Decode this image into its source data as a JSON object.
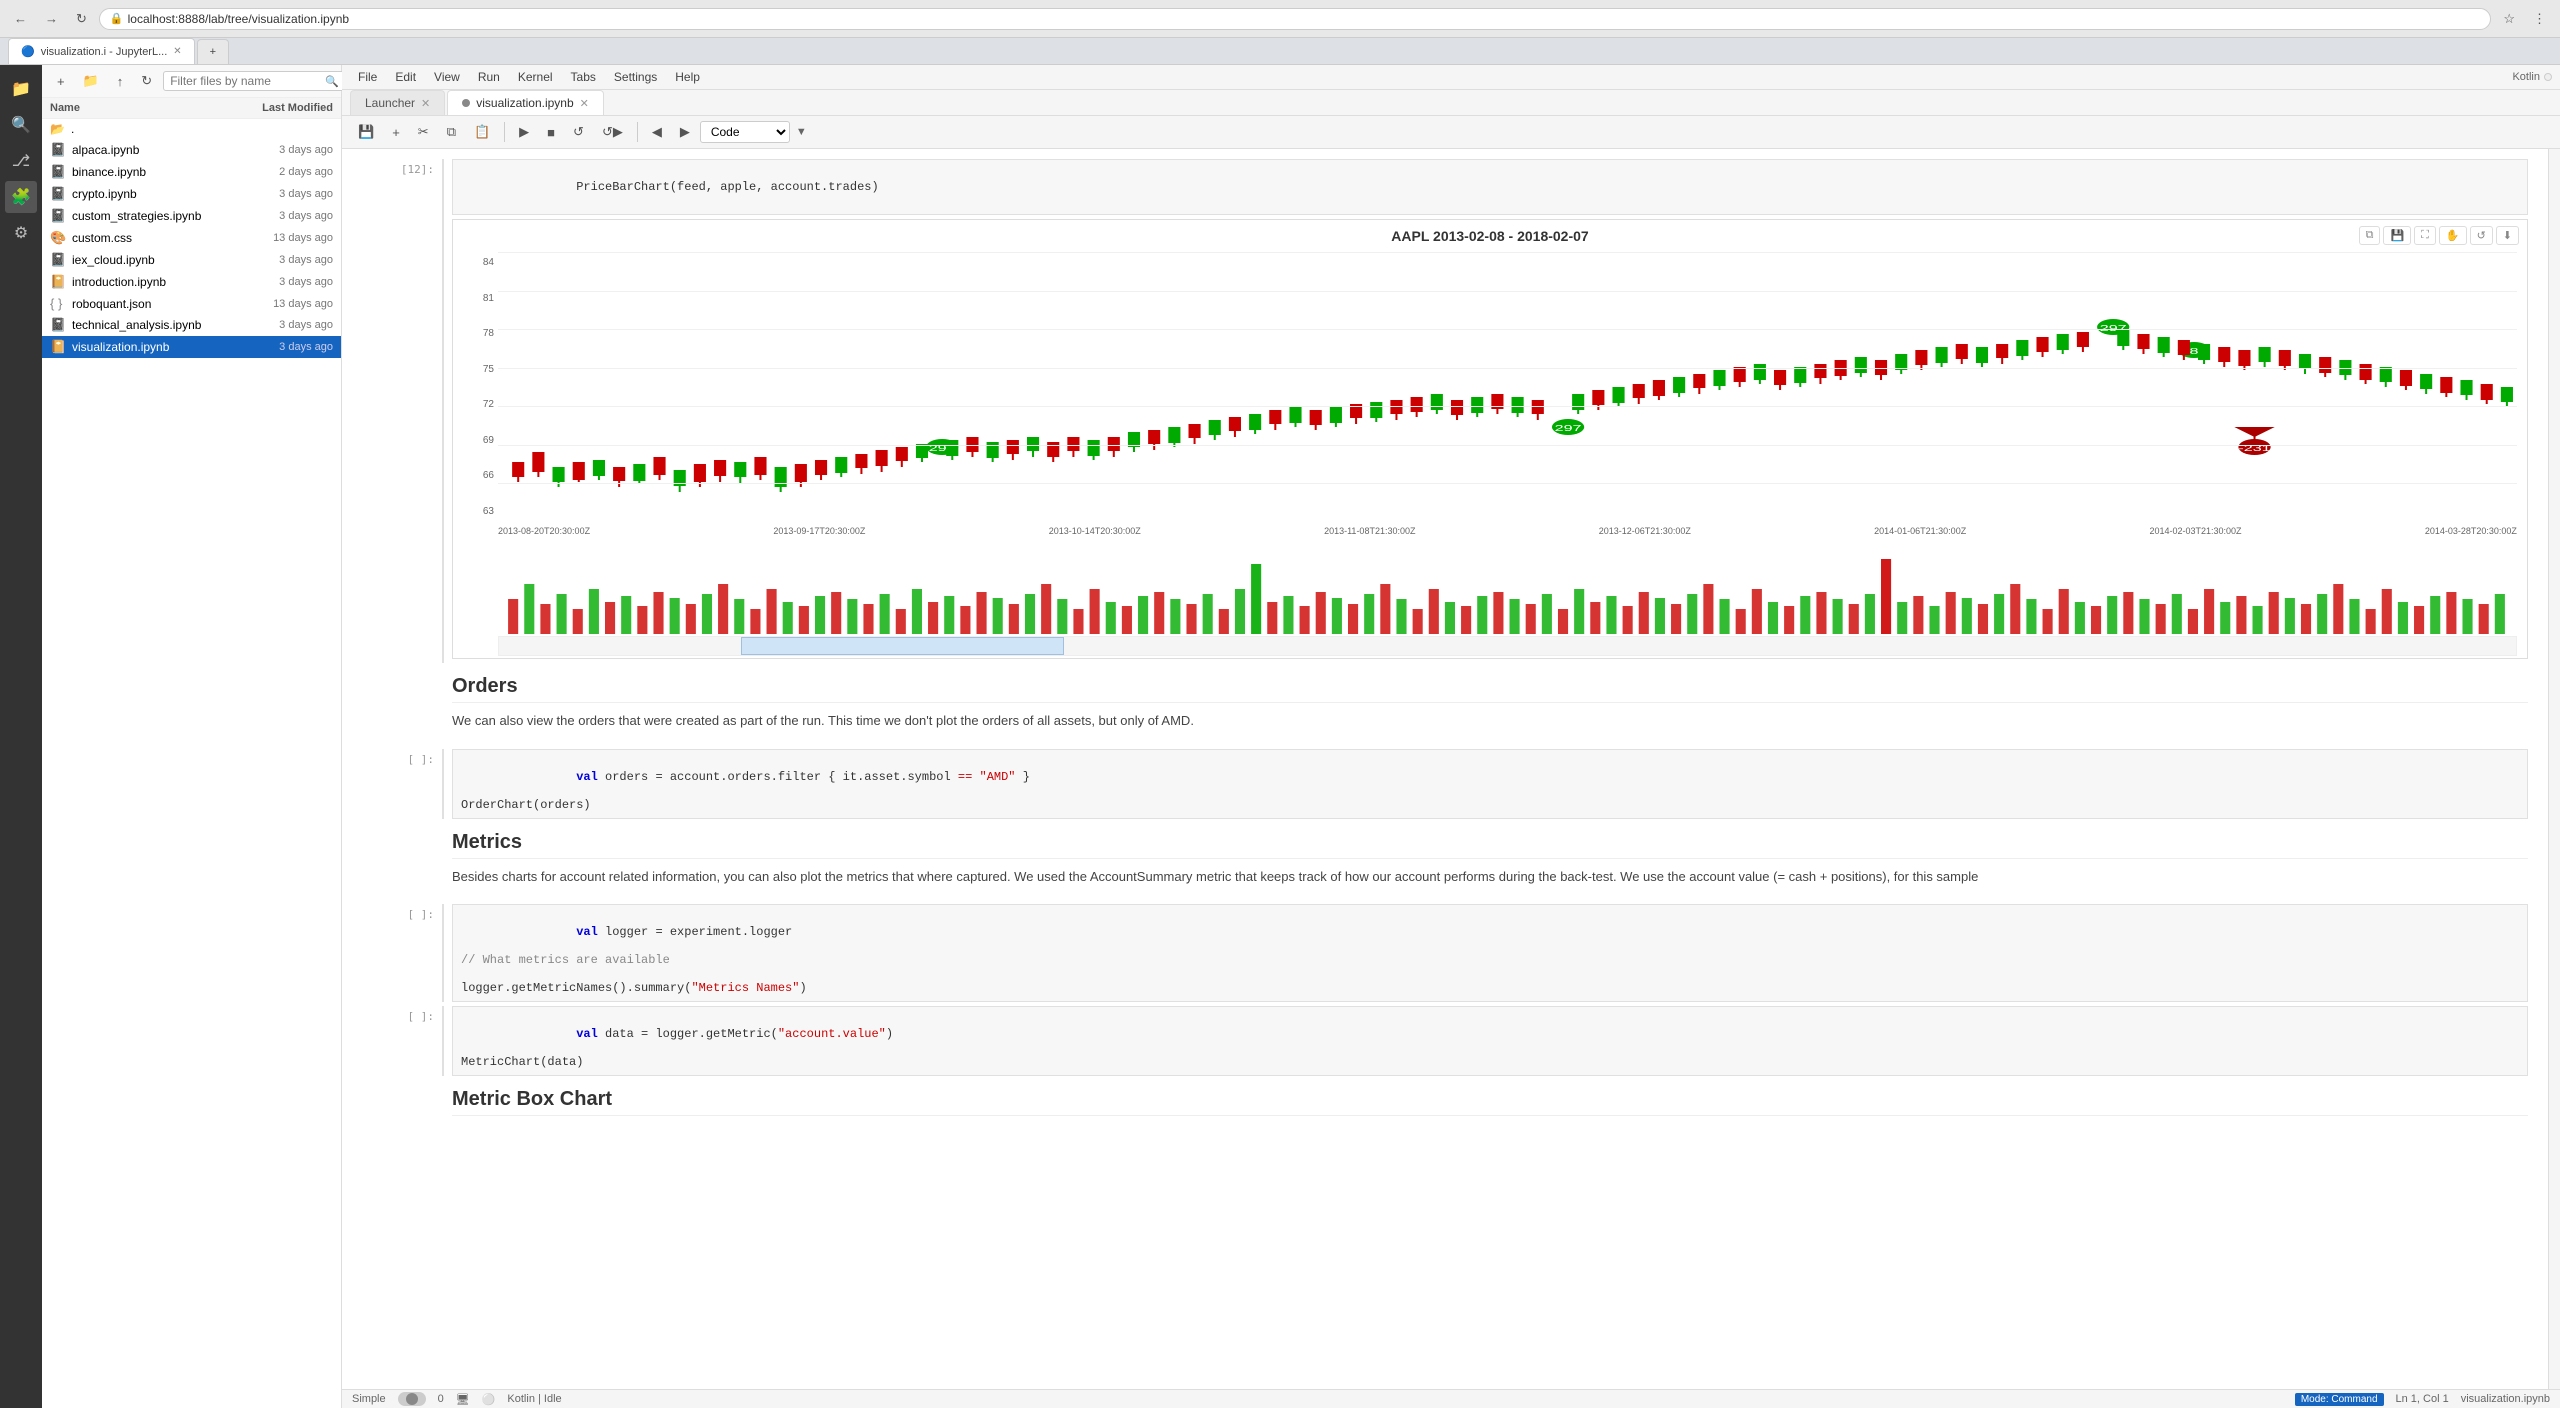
{
  "browser": {
    "tabs": [
      {
        "label": "visualization.i - JupyterL...",
        "active": false,
        "favicon": "🔵"
      },
      {
        "label": "+",
        "active": false
      }
    ],
    "address": "localhost:8888/lab/tree/visualization.ipynb",
    "nav": {
      "back": "←",
      "forward": "→",
      "refresh": "↻"
    }
  },
  "jupyterlab": {
    "menu": [
      "File",
      "Edit",
      "View",
      "Run",
      "Kernel",
      "Tabs",
      "Settings",
      "Help"
    ],
    "file_tabs": [
      {
        "label": "Launcher",
        "active": false,
        "closeable": true
      },
      {
        "label": "visualization.ipynb",
        "active": true,
        "closeable": true
      }
    ],
    "kernel_mode": "Code",
    "kernel_status": "Kotlin",
    "mode_indicator": "Command",
    "cell_info": "Ln 1, Col 1",
    "status_left": "Simple",
    "status_right_file": "visualization.ipynb"
  },
  "file_panel": {
    "search_placeholder": "Filter files by name",
    "col_name": "Name",
    "col_modified": "Last Modified",
    "folder": ".",
    "files": [
      {
        "name": "alpaca.ipynb",
        "modified": "3 days ago",
        "type": "notebook_orange",
        "selected": false
      },
      {
        "name": "binance.ipynb",
        "modified": "2 days ago",
        "type": "notebook_orange",
        "selected": false
      },
      {
        "name": "crypto.ipynb",
        "modified": "3 days ago",
        "type": "notebook_orange",
        "selected": false
      },
      {
        "name": "custom_strategies.ipynb",
        "modified": "3 days ago",
        "type": "notebook_orange",
        "selected": false
      },
      {
        "name": "custom.css",
        "modified": "13 days ago",
        "type": "css",
        "selected": false
      },
      {
        "name": "iex_cloud.ipynb",
        "modified": "3 days ago",
        "type": "notebook_orange",
        "selected": false
      },
      {
        "name": "introduction.ipynb",
        "modified": "3 days ago",
        "type": "notebook_blue",
        "selected": false
      },
      {
        "name": "roboquant.json",
        "modified": "13 days ago",
        "type": "json",
        "selected": false
      },
      {
        "name": "technical_analysis.ipynb",
        "modified": "3 days ago",
        "type": "notebook_orange",
        "selected": false
      },
      {
        "name": "visualization.ipynb",
        "modified": "3 days ago",
        "type": "notebook_blue",
        "selected": true
      }
    ]
  },
  "notebook": {
    "cell_prompt_1": "[12]:",
    "cell_code_1": "PriceBarChart(feed, apple, account.trades)",
    "chart_title": "AAPL 2013-02-08 - 2018-02-07",
    "y_labels": [
      "84",
      "81",
      "78",
      "75",
      "72",
      "69",
      "66",
      "63"
    ],
    "x_labels": [
      "2013-08-20T20:30:00Z",
      "2013-09-17T20:30:00Z",
      "2013-10-14T20:30:00Z",
      "2013-11-08T21:30:00Z",
      "2013-12-06T21:30:00Z",
      "2014-01-06T21:30:00Z",
      "2014-02-03T21:30:00Z",
      "2014-03-28T20:30:00Z"
    ],
    "orders_title": "Orders",
    "orders_text": "We can also view the orders that were created as part of the run. This time we don't plot the orders of all assets, but only of AMD.",
    "cell_prompt_2": "[ ]:",
    "cell_code_2": "val orders = account.orders.filter { it.asset.symbol == \"AMD\" }\nOrderChart(orders)",
    "metrics_title": "Metrics",
    "metrics_text": "Besides charts for account related information, you can also plot the metrics that where captured. We used the AccountSummary metric that keeps track of how our account performs during the back-test. We use the account value (= cash + positions), for this sample",
    "cell_prompt_3": "[ ]:",
    "cell_code_3_line1": "val logger = experiment.logger",
    "cell_code_3_line2": "// What metrics are available",
    "cell_code_3_line3": "logger.getMetricNames().summary(\"Metrics Names\")",
    "cell_prompt_4": "[ ]:",
    "cell_code_4_line1": "val data = logger.getMetric(\"account.value\")",
    "cell_code_4_line2": "MetricChart(data)",
    "metric_box_title": "Metric Box Chart"
  },
  "icons": {
    "folder": "📁",
    "search": "🔍",
    "notebook_orange": "📓",
    "notebook_blue": "📔",
    "json_file": "{}",
    "css_file": "🎨"
  }
}
